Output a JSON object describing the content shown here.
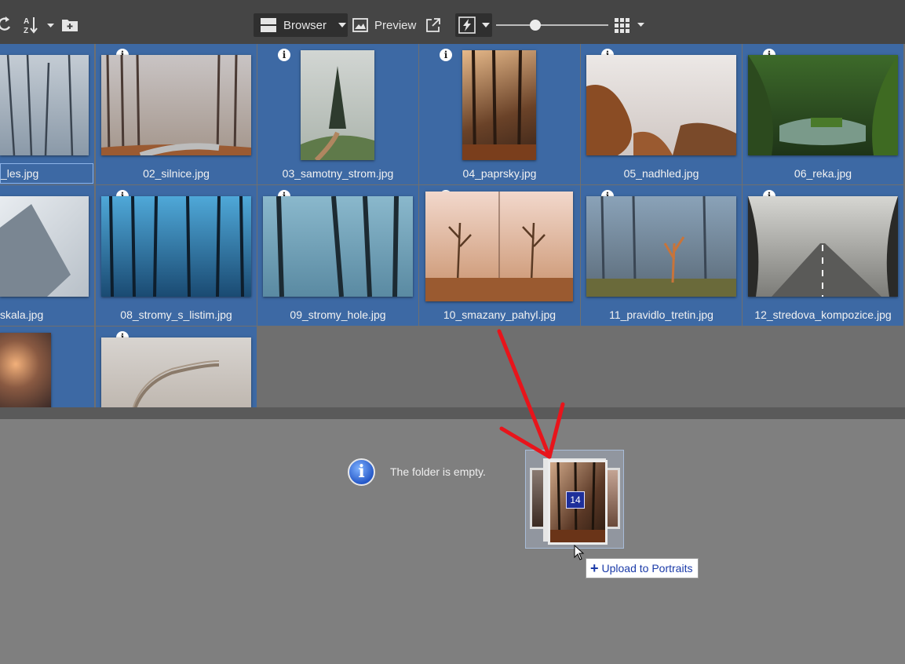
{
  "toolbar": {
    "browser_label": "Browser",
    "preview_label": "Preview"
  },
  "files": [
    {
      "name": "_les.jpg"
    },
    {
      "name": "02_silnice.jpg"
    },
    {
      "name": "03_samotny_strom.jpg"
    },
    {
      "name": "04_paprsky.jpg"
    },
    {
      "name": "05_nadhled.jpg"
    },
    {
      "name": "06_reka.jpg"
    },
    {
      "name": "skala.jpg"
    },
    {
      "name": "08_stromy_s_listim.jpg"
    },
    {
      "name": "09_stromy_hole.jpg"
    },
    {
      "name": "10_smazany_pahyl.jpg"
    },
    {
      "name": "11_pravidlo_tretin.jpg"
    },
    {
      "name": "12_stredova_kompozice.jpg"
    }
  ],
  "empty_folder": {
    "message": "The folder is empty."
  },
  "drag": {
    "count": "14",
    "tooltip": "Upload to Portraits"
  },
  "colors": {
    "selection": "#3d69a4",
    "accent_arrow": "#e8141b"
  }
}
